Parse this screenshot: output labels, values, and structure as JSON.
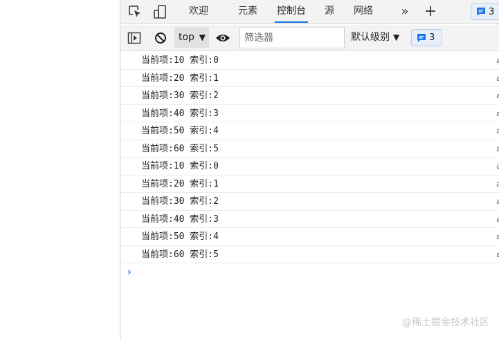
{
  "tabbar": {
    "tabs": [
      {
        "label": "欢迎",
        "active": false
      },
      {
        "label": "元素",
        "active": false
      },
      {
        "label": "控制台",
        "active": true
      },
      {
        "label": "源",
        "active": false
      },
      {
        "label": "网络",
        "active": false
      }
    ],
    "more_symbol": "»",
    "add_symbol": "+",
    "message_count": "3"
  },
  "toolbar": {
    "context": "top",
    "context_arrow": "▼",
    "filter_placeholder": "筛选器",
    "levels_label": "默认级别",
    "levels_arrow": "▼",
    "issues_count": "3"
  },
  "console": {
    "logs": [
      "当前项:10 索引:0",
      "当前项:20 索引:1",
      "当前项:30 索引:2",
      "当前项:40 索引:3",
      "当前项:50 索引:4",
      "当前项:60 索引:5",
      "当前项:10 索引:0",
      "当前项:20 索引:1",
      "当前项:30 索引:2",
      "当前项:40 索引:3",
      "当前项:50 索引:4",
      "当前项:60 索引:5"
    ],
    "prompt_symbol": "›"
  },
  "watermark": "@稀土掘金技术社区",
  "colors": {
    "accent": "#1a73e8",
    "toolbar_bg": "#f3f3f3",
    "badge_bg": "#e7effa"
  }
}
